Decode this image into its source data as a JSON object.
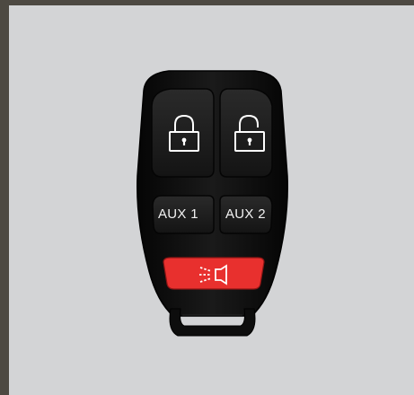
{
  "remote": {
    "buttons": [
      {
        "id": "lock",
        "icon": "lock-icon",
        "label": ""
      },
      {
        "id": "unlock",
        "icon": "unlock-icon",
        "label": ""
      },
      {
        "id": "aux1",
        "icon": "",
        "label": "AUX 1"
      },
      {
        "id": "aux2",
        "icon": "",
        "label": "AUX 2"
      },
      {
        "id": "panic",
        "icon": "horn-icon",
        "label": ""
      }
    ]
  },
  "colors": {
    "background_frame": "#4d4942",
    "panel": "#d3d4d6",
    "fob_body": "#0d0d0d",
    "buttons": "#1e1e1e",
    "panic_button": "#e8302e",
    "icon": "#ffffff"
  }
}
